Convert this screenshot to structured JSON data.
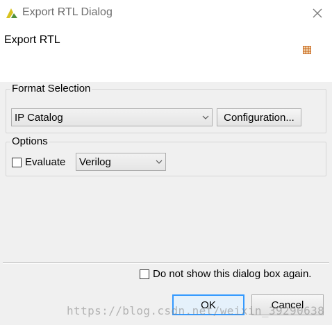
{
  "window": {
    "title": "Export RTL Dialog",
    "app_icon": "vivado-logo-icon",
    "close_icon": "close-icon"
  },
  "header": {
    "title": "Export RTL",
    "icon": "grid-icon"
  },
  "format_selection": {
    "label": "Format Selection",
    "format_value": "IP Catalog",
    "configuration_label": "Configuration..."
  },
  "options": {
    "label": "Options",
    "evaluate_label": "Evaluate",
    "evaluate_checked": false,
    "language_value": "Verilog"
  },
  "footer": {
    "dont_show_label": "Do not show this dialog box again.",
    "dont_show_checked": false,
    "ok_label": "OK",
    "cancel_label": "Cancel"
  },
  "watermark": {
    "text": "https://blog.csdn.net/weixin_39290638"
  },
  "colors": {
    "accent": "#3399ff",
    "logo_yellow": "#d8c21f",
    "logo_green": "#4f8f3a",
    "grid_icon": "#c8661e"
  }
}
